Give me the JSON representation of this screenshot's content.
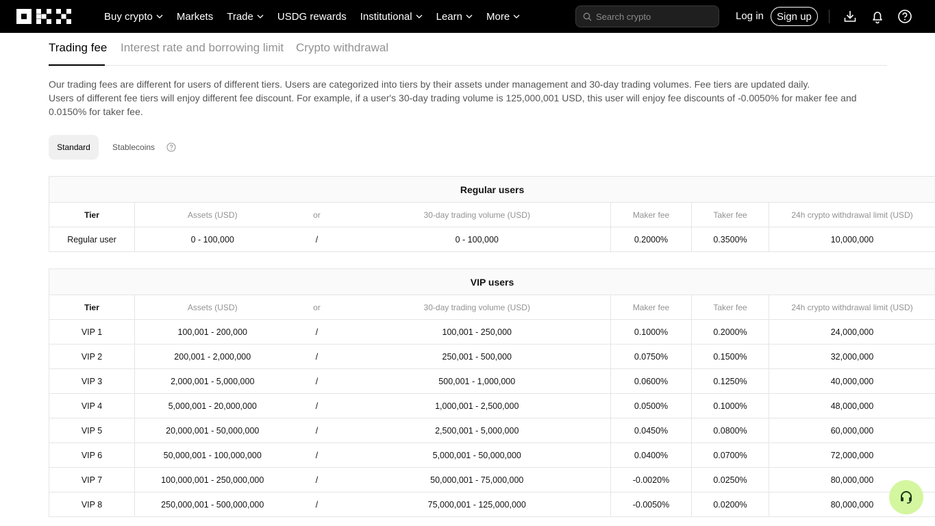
{
  "nav": {
    "menu": [
      {
        "label": "Buy crypto",
        "chevron": true
      },
      {
        "label": "Markets",
        "chevron": false
      },
      {
        "label": "Trade",
        "chevron": true
      },
      {
        "label": "USDG rewards",
        "chevron": false
      },
      {
        "label": "Institutional",
        "chevron": true
      },
      {
        "label": "Learn",
        "chevron": true
      },
      {
        "label": "More",
        "chevron": true
      }
    ],
    "search_placeholder": "Search crypto",
    "login": "Log in",
    "signup": "Sign up",
    "icons": [
      "download-icon",
      "bell-icon",
      "help-icon"
    ]
  },
  "tabs": [
    "Trading fee",
    "Interest rate and borrowing limit",
    "Crypto withdrawal"
  ],
  "description": {
    "line1": "Our trading fees are different for users of different tiers. Users are categorized into tiers by their assets under management and 30-day trading volumes. Fee tiers are updated daily.",
    "line2": "Users of different fee tiers will enjoy different fee discount. For example, if a user's 30-day trading volume is 125,000,001 USD, this user will enjoy fee discounts of -0.0050% for maker fee and 0.0150% for taker fee."
  },
  "segments": {
    "standard": "Standard",
    "stablecoins": "Stablecoins"
  },
  "columns": {
    "tier": "Tier",
    "assets": "Assets (USD)",
    "or": "or",
    "volume": "30-day trading volume (USD)",
    "maker": "Maker fee",
    "taker": "Taker fee",
    "withdrawal": "24h crypto withdrawal limit (USD)"
  },
  "regular": {
    "title": "Regular users",
    "rows": [
      {
        "tier": "Regular user",
        "assets": "0 - 100,000",
        "sep": "/",
        "volume": "0 - 100,000",
        "maker": "0.2000%",
        "taker": "0.3500%",
        "withdrawal": "10,000,000"
      }
    ]
  },
  "vip": {
    "title": "VIP users",
    "rows": [
      {
        "tier": "VIP 1",
        "assets": "100,001 - 200,000",
        "sep": "/",
        "volume": "100,001 - 250,000",
        "maker": "0.1000%",
        "taker": "0.2000%",
        "withdrawal": "24,000,000"
      },
      {
        "tier": "VIP 2",
        "assets": "200,001 - 2,000,000",
        "sep": "/",
        "volume": "250,001 - 500,000",
        "maker": "0.0750%",
        "taker": "0.1500%",
        "withdrawal": "32,000,000"
      },
      {
        "tier": "VIP 3",
        "assets": "2,000,001 - 5,000,000",
        "sep": "/",
        "volume": "500,001 - 1,000,000",
        "maker": "0.0600%",
        "taker": "0.1250%",
        "withdrawal": "40,000,000"
      },
      {
        "tier": "VIP 4",
        "assets": "5,000,001 - 20,000,000",
        "sep": "/",
        "volume": "1,000,001 - 2,500,000",
        "maker": "0.0500%",
        "taker": "0.1000%",
        "withdrawal": "48,000,000"
      },
      {
        "tier": "VIP 5",
        "assets": "20,000,001 - 50,000,000",
        "sep": "/",
        "volume": "2,500,001 - 5,000,000",
        "maker": "0.0450%",
        "taker": "0.0800%",
        "withdrawal": "60,000,000"
      },
      {
        "tier": "VIP 6",
        "assets": "50,000,001 - 100,000,000",
        "sep": "/",
        "volume": "5,000,001 - 50,000,000",
        "maker": "0.0400%",
        "taker": "0.0700%",
        "withdrawal": "72,000,000"
      },
      {
        "tier": "VIP 7",
        "assets": "100,000,001 - 250,000,000",
        "sep": "/",
        "volume": "50,000,001 - 75,000,000",
        "maker": "-0.0020%",
        "taker": "0.0250%",
        "withdrawal": "80,000,000"
      },
      {
        "tier": "VIP 8",
        "assets": "250,000,001 - 500,000,000",
        "sep": "/",
        "volume": "75,000,001 - 125,000,000",
        "maker": "-0.0050%",
        "taker": "0.0200%",
        "withdrawal": "80,000,000"
      }
    ]
  },
  "colors": {
    "accent": "#d4f69f",
    "nav_bg": "#000000",
    "muted": "#929292"
  }
}
